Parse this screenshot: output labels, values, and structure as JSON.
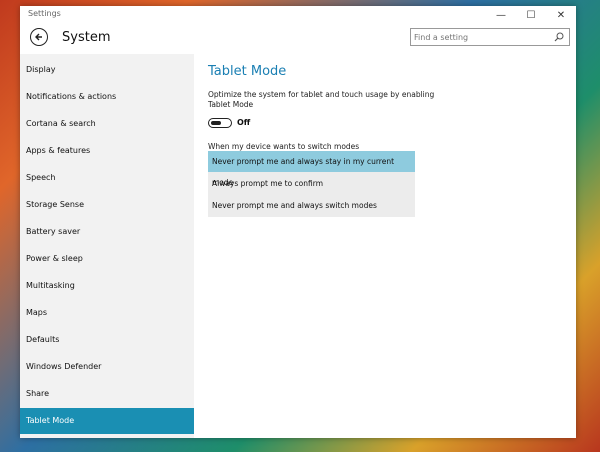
{
  "window": {
    "app_title": "Settings"
  },
  "controls": {
    "minimize": "—",
    "maximize": "☐",
    "close": "✕"
  },
  "header": {
    "back_icon": "back-arrow-icon",
    "title": "System"
  },
  "search": {
    "placeholder": "Find a setting",
    "icon": "search-icon"
  },
  "sidebar": {
    "items": [
      {
        "label": "Display"
      },
      {
        "label": "Notifications & actions"
      },
      {
        "label": "Cortana & search"
      },
      {
        "label": "Apps & features"
      },
      {
        "label": "Speech"
      },
      {
        "label": "Storage Sense"
      },
      {
        "label": "Battery saver"
      },
      {
        "label": "Power & sleep"
      },
      {
        "label": "Multitasking"
      },
      {
        "label": "Maps"
      },
      {
        "label": "Defaults"
      },
      {
        "label": "Windows Defender"
      },
      {
        "label": "Share"
      },
      {
        "label": "Tablet Mode"
      }
    ],
    "active_index": 13
  },
  "main": {
    "title": "Tablet Mode",
    "description": "Optimize the system for tablet and touch usage by enabling Tablet Mode",
    "toggle_state": "Off",
    "switch_label": "When my device wants to switch modes",
    "options": [
      {
        "label": "Never prompt me and always stay in my current mode"
      },
      {
        "label": "Always prompt me to confirm"
      },
      {
        "label": "Never prompt me and always switch modes"
      }
    ],
    "selected_option": 0
  },
  "colors": {
    "accent": "#1a8fb3",
    "title_blue": "#1a7fb3",
    "selected_option": "#8ecbde"
  }
}
